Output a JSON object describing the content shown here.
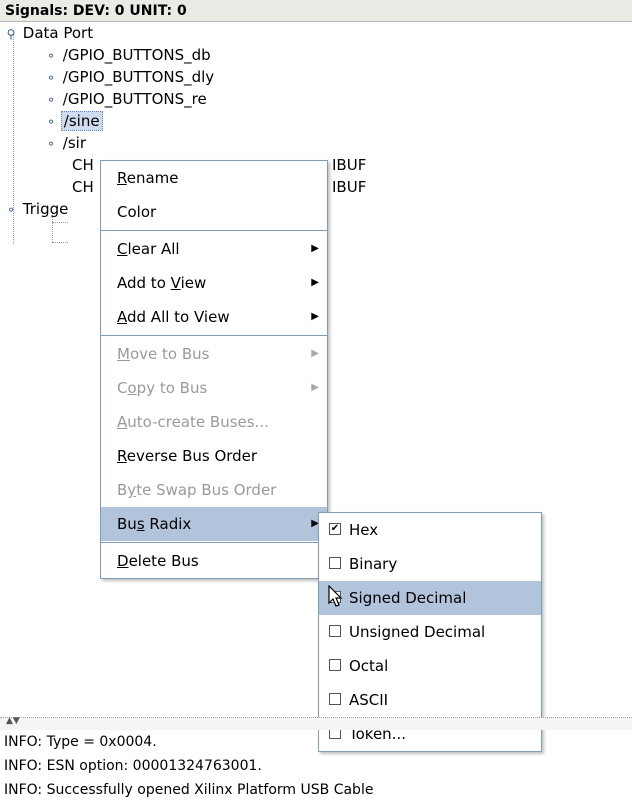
{
  "header": {
    "title": "Signals: DEV: 0 UNIT: 0"
  },
  "tree": {
    "root": "Data Port",
    "signals": [
      "/GPIO_BUTTONS_db",
      "/GPIO_BUTTONS_dly",
      "/GPIO_BUTTONS_re",
      "/sine",
      "/sir"
    ],
    "channels": [
      "CH",
      "CH"
    ],
    "channel_suffixes": [
      "IBUF",
      "IBUF"
    ],
    "trigger": "Trigge"
  },
  "context_menu": {
    "items": [
      {
        "pre": "",
        "u": "R",
        "post": "ename"
      },
      {
        "pre": "",
        "u": "",
        "post": "Color"
      },
      {
        "pre": "",
        "u": "C",
        "post": "lear All"
      },
      {
        "pre": "Add to ",
        "u": "V",
        "post": "iew"
      },
      {
        "pre": "",
        "u": "A",
        "post": "dd All to View"
      },
      {
        "pre": "",
        "u": "M",
        "post": "ove to Bus"
      },
      {
        "pre": "C",
        "u": "o",
        "post": "py to Bus"
      },
      {
        "pre": "",
        "u": "A",
        "post": "uto-create Buses..."
      },
      {
        "pre": "",
        "u": "R",
        "post": "everse Bus Order"
      },
      {
        "pre": "B",
        "u": "y",
        "post": "te Swap Bus Order"
      },
      {
        "pre": "Bu",
        "u": "s",
        "post": " Radix"
      },
      {
        "pre": "",
        "u": "D",
        "post": "elete Bus"
      }
    ]
  },
  "radix_submenu": {
    "items": [
      {
        "label": "Hex",
        "checked": true
      },
      {
        "label": "Binary",
        "checked": false
      },
      {
        "label": "Signed Decimal",
        "checked": false
      },
      {
        "label": "Unsigned Decimal",
        "checked": false
      },
      {
        "label": "Octal",
        "checked": false
      },
      {
        "label": "ASCII",
        "checked": false
      },
      {
        "label": "Token...",
        "checked": false
      }
    ]
  },
  "console": {
    "lines": [
      "INFO: Type = 0x0004.",
      "INFO: ESN option: 00001324763001.",
      "INFO: Successfully opened Xilinx Platform USB Cable"
    ]
  },
  "colors": {
    "menu_highlight": "#b2c3dc",
    "selection": "#cfdcf0",
    "border": "#7f9db9"
  }
}
